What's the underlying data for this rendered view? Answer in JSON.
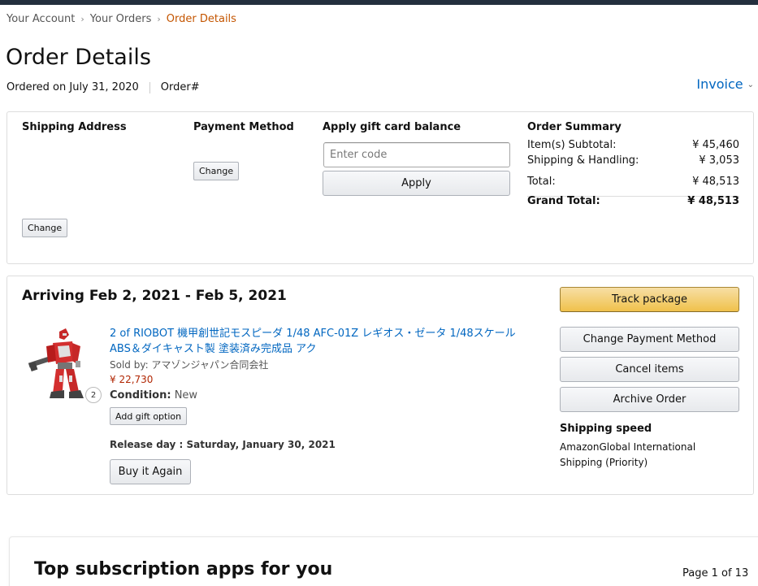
{
  "breadcrumb": {
    "items": [
      "Your Account",
      "Your Orders",
      "Order Details"
    ]
  },
  "page_title": "Order Details",
  "order_meta": {
    "ordered_on": "Ordered on July 31, 2020",
    "order_number_label": "Order#"
  },
  "invoice_label": "Invoice",
  "info_box": {
    "shipping_address_label": "Shipping Address",
    "payment_method_label": "Payment Method",
    "change_label": "Change",
    "gift_card_label": "Apply gift card balance",
    "gift_card_placeholder": "Enter code",
    "apply_label": "Apply",
    "summary": {
      "title": "Order Summary",
      "rows": [
        {
          "label": "Item(s) Subtotal:",
          "value": "¥ 45,460"
        },
        {
          "label": "Shipping & Handling:",
          "value": "¥ 3,053"
        },
        {
          "label": "Total:",
          "value": "¥ 48,513"
        },
        {
          "label": "Grand Total:",
          "value": "¥ 48,513"
        }
      ]
    }
  },
  "shipment": {
    "arriving": "Arriving Feb 2, 2021 - Feb 5, 2021",
    "product_title": "2 of RIOBOT 機甲創世記モスピーダ 1/48 AFC-01Z レギオス・ゼータ 1/48スケール ABS＆ダイキャスト製 塗装済み完成品 アク",
    "sold_by": "Sold by: アマゾンジャパン合同会社",
    "price": "¥ 22,730",
    "condition_label": "Condition:",
    "condition_value": "New",
    "quantity": "2",
    "add_gift_label": "Add gift option",
    "release_day": "Release day : Saturday, January 30, 2021",
    "buy_again_label": "Buy it Again",
    "actions": {
      "track": "Track package",
      "change_payment": "Change Payment Method",
      "cancel": "Cancel items",
      "archive": "Archive Order"
    },
    "shipping_speed_label": "Shipping speed",
    "shipping_speed_value": "AmazonGlobal International Shipping (Priority)"
  },
  "recommendations": {
    "title": "Top subscription apps for you",
    "page": "Page 1 of 13"
  },
  "colors": {
    "link": "#0066c0",
    "breadcrumb_current": "#c45500",
    "price": "#b12704",
    "track_button": "#f0c14b",
    "top_bar": "#232f3e"
  }
}
